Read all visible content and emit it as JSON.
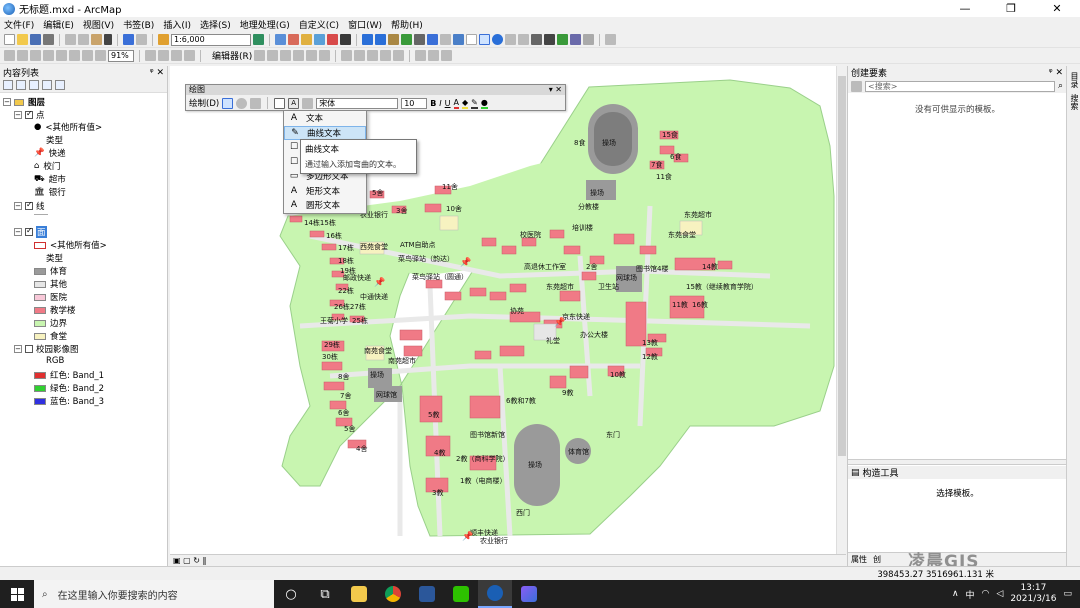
{
  "window": {
    "title": "无标题.mxd - ArcMap",
    "controls": [
      "—",
      "❐",
      "✕"
    ]
  },
  "menu": [
    "文件(F)",
    "编辑(E)",
    "视图(V)",
    "书签(B)",
    "插入(I)",
    "选择(S)",
    "地理处理(G)",
    "自定义(C)",
    "窗口(W)",
    "帮助(H)"
  ],
  "toolbar": {
    "scale": "1:6,000",
    "zoom": "91%",
    "editor": "编辑器(R)"
  },
  "toc": {
    "title": "内容列表",
    "items": [
      {
        "label": "图层",
        "level": 0,
        "kind": "group"
      },
      {
        "label": "点",
        "level": 1,
        "kind": "layer"
      },
      {
        "label": "<其他所有值>",
        "level": 2,
        "kind": "value"
      },
      {
        "label": "类型",
        "level": 2,
        "kind": "heading"
      },
      {
        "label": "快递",
        "level": 2,
        "kind": "value"
      },
      {
        "label": "校门",
        "level": 2,
        "kind": "value"
      },
      {
        "label": "超市",
        "level": 2,
        "kind": "value"
      },
      {
        "label": "银行",
        "level": 2,
        "kind": "value"
      },
      {
        "label": "线",
        "level": 1,
        "kind": "layer"
      },
      {
        "label": "面",
        "level": 1,
        "kind": "layer"
      },
      {
        "label": "<其他所有值>",
        "level": 2,
        "kind": "value"
      },
      {
        "label": "类型",
        "level": 2,
        "kind": "heading"
      },
      {
        "label": "体育",
        "level": 2,
        "kind": "value",
        "color": "#9a9a9a"
      },
      {
        "label": "其他",
        "level": 2,
        "kind": "value",
        "color": "#e6e6e6"
      },
      {
        "label": "医院",
        "level": 2,
        "kind": "value",
        "color": "#f8c8d8"
      },
      {
        "label": "教学楼",
        "level": 2,
        "kind": "value",
        "color": "#f07a86"
      },
      {
        "label": "边界",
        "level": 2,
        "kind": "value",
        "color": "#c8f5b0"
      },
      {
        "label": "食堂",
        "level": 2,
        "kind": "value",
        "color": "#f7f2c0"
      },
      {
        "label": "校园影像图",
        "level": 1,
        "kind": "raster"
      },
      {
        "label": "RGB",
        "level": 2,
        "kind": "heading"
      },
      {
        "label": "红色:   Band_1",
        "level": 2,
        "kind": "value",
        "color": "#e03030"
      },
      {
        "label": "绿色:  Band_2",
        "level": 2,
        "kind": "value",
        "color": "#30d030"
      },
      {
        "label": "蓝色:   Band_3",
        "level": 2,
        "kind": "value",
        "color": "#3030e0"
      }
    ]
  },
  "draw": {
    "title": "绘图",
    "menu_label": "绘制(D)",
    "font": "宋体",
    "size": "10",
    "dropdown": [
      {
        "label": "文本",
        "icon": "A"
      },
      {
        "label": "曲线文本",
        "icon": "✎"
      },
      {
        "label": "标注",
        "icon": "☐"
      },
      {
        "label": "多边形文本",
        "icon": "▭"
      },
      {
        "label": "矩形文本",
        "icon": "A"
      },
      {
        "label": "圆形文本",
        "icon": "A"
      }
    ],
    "tooltip_title": "曲线文本",
    "tooltip_desc": "通过输入添加弯曲的文本。"
  },
  "map": {
    "labels": [
      {
        "t": "操场",
        "c": "sports"
      },
      {
        "t": "15食"
      },
      {
        "t": "8食"
      },
      {
        "t": "6食"
      },
      {
        "t": "7食"
      },
      {
        "t": "11食"
      },
      {
        "t": "操场"
      },
      {
        "t": "分教楼"
      },
      {
        "t": "东苑超市"
      },
      {
        "t": "东苑食堂"
      },
      {
        "t": "农业银行"
      },
      {
        "t": "11舍"
      },
      {
        "t": "10舍"
      },
      {
        "t": "3舍"
      },
      {
        "t": "5舍"
      },
      {
        "t": "14栋15栋"
      },
      {
        "t": "16栋"
      },
      {
        "t": "17栋"
      },
      {
        "t": "18栋"
      },
      {
        "t": "19栋"
      },
      {
        "t": "西苑食堂"
      },
      {
        "t": "ATM自助点"
      },
      {
        "t": "菜鸟驿站（韵达）"
      },
      {
        "t": "菜鸟驿站（圆通）"
      },
      {
        "t": "邮政快递"
      },
      {
        "t": "中通快递"
      },
      {
        "t": "22栋"
      },
      {
        "t": "26栋27栋"
      },
      {
        "t": "25栋"
      },
      {
        "t": "校医院"
      },
      {
        "t": "培训楼"
      },
      {
        "t": "2舍"
      },
      {
        "t": "高退休工作室"
      },
      {
        "t": "东苑超市"
      },
      {
        "t": "图书馆4楼"
      },
      {
        "t": "网球场"
      },
      {
        "t": "卫生站"
      },
      {
        "t": "14教"
      },
      {
        "t": "15教（继续教育学院）"
      },
      {
        "t": "11教"
      },
      {
        "t": "16教"
      },
      {
        "t": "京东快递"
      },
      {
        "t": "协苑"
      },
      {
        "t": "办公大楼"
      },
      {
        "t": "礼堂"
      },
      {
        "t": "13教"
      },
      {
        "t": "12教"
      },
      {
        "t": "10教"
      },
      {
        "t": "南苑食堂"
      },
      {
        "t": "南苑超市"
      },
      {
        "t": "王菊小学"
      },
      {
        "t": "29栋"
      },
      {
        "t": "30栋"
      },
      {
        "t": "操场"
      },
      {
        "t": "网球馆"
      },
      {
        "t": "8舍"
      },
      {
        "t": "7舍"
      },
      {
        "t": "6舍"
      },
      {
        "t": "4舍"
      },
      {
        "t": "5舍"
      },
      {
        "t": "9教"
      },
      {
        "t": "5教"
      },
      {
        "t": "6教和7教"
      },
      {
        "t": "4教"
      },
      {
        "t": "图书馆新馆"
      },
      {
        "t": "2教（商科学院）"
      },
      {
        "t": "1教（电商楼）"
      },
      {
        "t": "3教"
      },
      {
        "t": "操场"
      },
      {
        "t": "体育馆"
      },
      {
        "t": "东门"
      },
      {
        "t": "西门"
      },
      {
        "t": "顺丰快递"
      },
      {
        "t": "农业银行"
      }
    ]
  },
  "create_features": {
    "title": "创建要素",
    "search_placeholder": "<搜索>",
    "empty": "没有可供显示的模板。",
    "construct_title": "构造工具",
    "construct_msg": "选择模板。",
    "bottom_tabs": [
      "属性",
      "创"
    ]
  },
  "side_tabs": [
    "目录",
    "搜索"
  ],
  "status": {
    "coords": "398453.27  3516961.131 米"
  },
  "watermark": "凌晨GIS",
  "taskbar": {
    "search": "在这里输入你要搜索的内容",
    "ime": "中",
    "time": "13:17",
    "date": "2021/3/16"
  }
}
